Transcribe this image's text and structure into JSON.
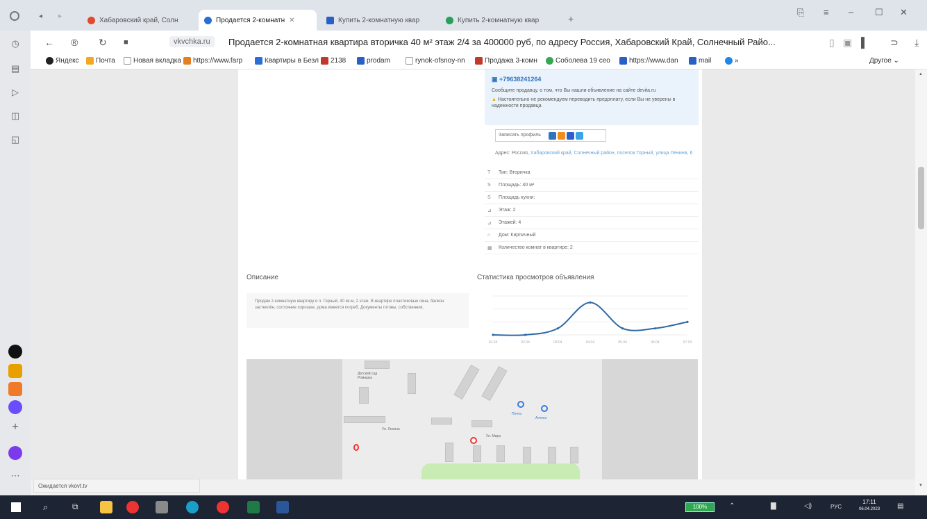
{
  "tabs": [
    {
      "title": "Хабаровский край, Солн",
      "active": false,
      "color": "#e04a2f"
    },
    {
      "title": "Продается 2-комнатн",
      "active": true,
      "color": "#2a6fd6"
    },
    {
      "title": "Купить 2-комнатную квар",
      "active": false,
      "color": "#2a5fc8"
    },
    {
      "title": "Купить 2-комнатную квар",
      "active": false,
      "color": "#27a05a"
    }
  ],
  "address_bar": {
    "domain": "vkvchka.ru",
    "title": "Продается 2-комнатная квартира вторичка 40 м² этаж 2/4 за 400000 руб, по адресу Россия, Хабаровский Край, Солнечный Райо..."
  },
  "bookmarks": [
    {
      "label": "Яндекс",
      "color": "#e33"
    },
    {
      "label": "Почта",
      "color": "#f5a623"
    },
    {
      "label": "Новая вкладка",
      "color": "#999"
    },
    {
      "label": "https://www.farp",
      "color": "#e67e22"
    },
    {
      "label": "Квартиры в Безл",
      "color": "#2a6fd6"
    },
    {
      "label": "2138",
      "color": "#c0392b"
    },
    {
      "label": "prodam",
      "color": "#2a5fc8"
    },
    {
      "label": "rynok-ofsnoy-nn",
      "color": "#999"
    },
    {
      "label": "Продажа 3-комн",
      "color": "#c0392b"
    },
    {
      "label": "Соболева 19 сео",
      "color": "#34a853"
    },
    {
      "label": "https://www.dan",
      "color": "#2a5fc8"
    },
    {
      "label": "mail",
      "color": "#2a5fc8"
    }
  ],
  "bookmarks_more": "Другое",
  "contact": {
    "phone": "+79638241264",
    "message": "Сообщите продавцу, о том, что Вы нашли объявление на сайте devita.ru",
    "warning": "Настоятельно не рекомендуем переводить предоплату, если Вы не уверены в надежности продавца"
  },
  "share_label": "Записать профиль",
  "address_line": {
    "prefix": "Адрес: Россия,",
    "link": "Хабаровский край, Солнечный район, поселок Горный, улица Ленина, 6"
  },
  "properties": [
    {
      "icon": "T",
      "text": "Тип: Вторичка"
    },
    {
      "icon": "S",
      "text": "Площадь: 40 м²"
    },
    {
      "icon": "S",
      "text": "Площадь кухни:"
    },
    {
      "icon": "⊿",
      "text": "Этаж: 2"
    },
    {
      "icon": "⊿",
      "text": "Этажей: 4"
    },
    {
      "icon": "⌂",
      "text": "Дом: Кирпичный"
    },
    {
      "icon": "▦",
      "text": "Количество комнат в квартире: 2"
    }
  ],
  "description": {
    "title": "Описание",
    "text": "Продам 2-комнатную квартиру в п. Горный, 40 кв.м, 2 этаж. В квартире пластиковые окна, балкон застеклён, состояние хорошее, дома имеется погреб. Документы готовы, собственник."
  },
  "chart_data": {
    "type": "line",
    "title": "Статистика просмотров объявления",
    "categories": [
      "01.04",
      "02.04",
      "03.04",
      "04.04",
      "05.04",
      "06.04",
      "07.04"
    ],
    "values": [
      0,
      0,
      1,
      5,
      1,
      1,
      2
    ],
    "ylim": [
      0,
      6
    ],
    "color": "#2d6aa3",
    "grid": true
  },
  "map": {
    "labels": [
      "Детский сад Ромашка",
      "Ул. Ленина",
      "Почта",
      "Аптека",
      "Ул. Мира"
    ]
  },
  "status_text": "Ожидается vkovt.tv",
  "taskbar": {
    "battery": "100%",
    "lang": "РУС",
    "time": "17:11",
    "date": "06.04.2023"
  }
}
